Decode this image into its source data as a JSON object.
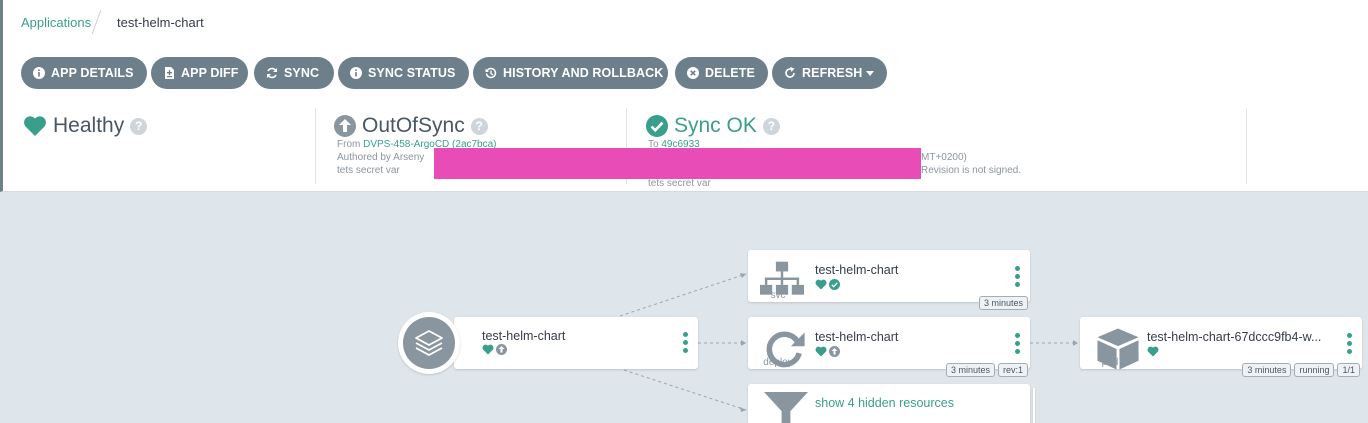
{
  "breadcrumb": {
    "parent": "Applications",
    "current": "test-helm-chart"
  },
  "toolbar": {
    "app_details": "APP DETAILS",
    "app_diff": "APP DIFF",
    "sync": "SYNC",
    "sync_status": "SYNC STATUS",
    "history": "HISTORY AND ROLLBACK",
    "delete": "DELETE",
    "refresh": "REFRESH"
  },
  "health": {
    "label": "Healthy",
    "help": "?"
  },
  "out_of_sync": {
    "label": "OutOfSync",
    "help": "?",
    "from_prefix": "From",
    "from_link": "DVPS-458-ArgoCD (2ac7bca)",
    "authored": "Authored by Arseny",
    "message": "tets secret var"
  },
  "sync_ok": {
    "label": "Sync OK",
    "help": "?",
    "to_prefix": "To",
    "to_link": "49c6933",
    "tz_fragment": "MT+0200)",
    "signed": "Revision is not signed.",
    "message": "tets secret var"
  },
  "graph": {
    "app_node": {
      "name": "test-helm-chart"
    },
    "svc_node": {
      "name": "test-helm-chart",
      "kind": "svc",
      "age": "3 minutes"
    },
    "deploy_node": {
      "name": "test-helm-chart",
      "kind": "deploy",
      "age": "3 minutes",
      "rev": "rev:1"
    },
    "pod_node": {
      "name": "test-helm-chart-67dccc9fb4-w...",
      "kind": "pod",
      "age": "3 minutes",
      "state": "running",
      "ready": "1/1"
    },
    "hidden_node": {
      "label": "show 4 hidden resources"
    }
  },
  "colors": {
    "accent": "#3a9e8d",
    "button": "#6d7f8b",
    "redaction": "#e84db7"
  }
}
